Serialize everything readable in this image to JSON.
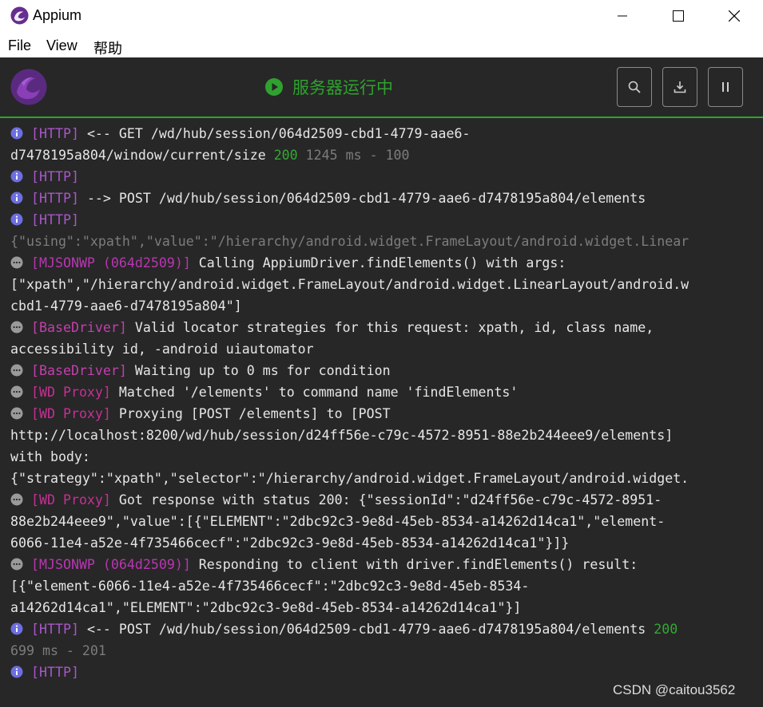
{
  "window": {
    "title": "Appium",
    "controls": {
      "minimize": "minimize",
      "maximize": "maximize",
      "close": "close"
    }
  },
  "menu": [
    "File",
    "View",
    "帮助"
  ],
  "toolbar": {
    "status_text": "服务器运行中",
    "buttons": [
      "search-icon",
      "download-icon",
      "pause-icon"
    ]
  },
  "colors": {
    "accent_green": "#2fa12f",
    "http_tag": "#a857c9",
    "background": "#272727"
  },
  "log": [
    {
      "icon": "info",
      "tag": "[HTTP]",
      "text": " <-- GET /wd/hub/session/064d2509-cbd1-4779-aae6-"
    },
    {
      "icon": "",
      "tag": "",
      "text": "d7478195a804/window/current/size ",
      "code": "200",
      "dim": " 1245 ms - 100"
    },
    {
      "icon": "info",
      "tag": "[HTTP]",
      "text": ""
    },
    {
      "icon": "info",
      "tag": "[HTTP]",
      "text": " --> POST /wd/hub/session/064d2509-cbd1-4779-aae6-d7478195a804/elements"
    },
    {
      "icon": "info",
      "tag": "[HTTP]",
      "text": ""
    },
    {
      "icon": "",
      "tag": "",
      "text": "",
      "dim": "{\"using\":\"xpath\",\"value\":\"/hierarchy/android.widget.FrameLayout/android.widget.Linear"
    },
    {
      "icon": "debug",
      "tag": "[MJSONWP (064d2509)]",
      "text": " Calling AppiumDriver.findElements() with args:"
    },
    {
      "icon": "",
      "tag": "",
      "text": "[\"xpath\",\"/hierarchy/android.widget.FrameLayout/android.widget.LinearLayout/android.w"
    },
    {
      "icon": "",
      "tag": "",
      "text": "cbd1-4779-aae6-d7478195a804\"]"
    },
    {
      "icon": "debug",
      "tag": "[BaseDriver]",
      "text": " Valid locator strategies for this request: xpath, id, class name,"
    },
    {
      "icon": "",
      "tag": "",
      "text": "accessibility id, -android uiautomator"
    },
    {
      "icon": "debug",
      "tag": "[BaseDriver]",
      "text": " Waiting up to 0 ms for condition"
    },
    {
      "icon": "debug",
      "tag": "[WD Proxy]",
      "text": " Matched '/elements' to command name 'findElements'"
    },
    {
      "icon": "debug",
      "tag": "[WD Proxy]",
      "text": " Proxying [POST /elements] to [POST"
    },
    {
      "icon": "",
      "tag": "",
      "text": "http://localhost:8200/wd/hub/session/d24ff56e-c79c-4572-8951-88e2b244eee9/elements]"
    },
    {
      "icon": "",
      "tag": "",
      "text": "with body:"
    },
    {
      "icon": "",
      "tag": "",
      "text": "{\"strategy\":\"xpath\",\"selector\":\"/hierarchy/android.widget.FrameLayout/android.widget."
    },
    {
      "icon": "debug",
      "tag": "[WD Proxy]",
      "text": " Got response with status 200: {\"sessionId\":\"d24ff56e-c79c-4572-8951-"
    },
    {
      "icon": "",
      "tag": "",
      "text": "88e2b244eee9\",\"value\":[{\"ELEMENT\":\"2dbc92c3-9e8d-45eb-8534-a14262d14ca1\",\"element-"
    },
    {
      "icon": "",
      "tag": "",
      "text": "6066-11e4-a52e-4f735466cecf\":\"2dbc92c3-9e8d-45eb-8534-a14262d14ca1\"}]}"
    },
    {
      "icon": "debug",
      "tag": "[MJSONWP (064d2509)]",
      "text": " Responding to client with driver.findElements() result:"
    },
    {
      "icon": "",
      "tag": "",
      "text": "[{\"element-6066-11e4-a52e-4f735466cecf\":\"2dbc92c3-9e8d-45eb-8534-"
    },
    {
      "icon": "",
      "tag": "",
      "text": "a14262d14ca1\",\"ELEMENT\":\"2dbc92c3-9e8d-45eb-8534-a14262d14ca1\"}]"
    },
    {
      "icon": "info",
      "tag": "[HTTP]",
      "text": " <-- POST /wd/hub/session/064d2509-cbd1-4779-aae6-d7478195a804/elements ",
      "code": "200"
    },
    {
      "icon": "",
      "tag": "",
      "text": "",
      "dim": "699 ms - 201"
    },
    {
      "icon": "info",
      "tag": "[HTTP]",
      "text": ""
    }
  ],
  "watermark": "CSDN @caitou3562"
}
